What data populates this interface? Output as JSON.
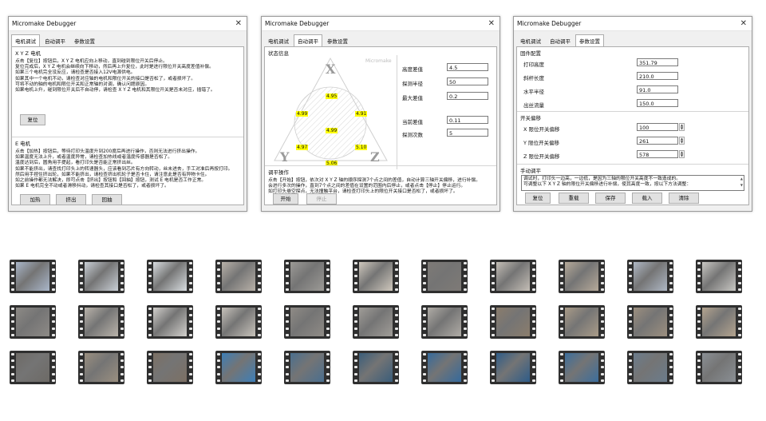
{
  "window1": {
    "title": "Micromake Debugger",
    "tabs": [
      "电机调试",
      "自动调平",
      "参数设置"
    ],
    "xyz_group": {
      "title": "X Y Z 电机",
      "text": "点击【复位】按钮后，X Y Z 电机应向上移动，直到碰到限位开关后停止。\n复位完成后，X Y Z 电机会继续向下移动，然后再上升复位，此时是进行限位开关高度差值补偿。\n如果三个电机完全没反应，请检查是否接入12V电源供电。\n如果其中一个电机不动，请检查对应轴的电机和限位开关的接口是否松了，或者损坏了。\n可将不动的轴的电机和限位开关和正常轴的对调，确认问题原因。\n如果电机上升，碰到限位开关后不自动停，请检查 X Y Z 电机和其限位开关是否未对应，插错了。",
      "reset_label": "复位"
    },
    "e_group": {
      "title": "E 电机",
      "text": "点击【加热】按钮后，等待打印头温度升到200度后再进行操作，否则无法进行挤出操作。\n如果温度无法上升，或者温度异常，请检查加热线或者温度传感器是否松了。\n温度达到后，圆角用手提起，看打印头是否能正常挤出丝。\n如果不能挤出，请查找打印头上的转速器头，应该看到芯片有方向转动，丝未进去，手工对准后再按打印。\n然后用手捏住挤出轮，如果不能挤出，请检查挤出机轮子是否卡住，请注意此是否有异物卡住。\n如之前操作都无法解决，即可点击【挤出】按钮和【回抽】按钮，测试 E 电机是否工作正常。\n如果 E 电机完全不动或者滑移抖动，请检查其接口是否松了，或者损坏了。",
      "buttons": [
        "加热",
        "挤出",
        "回抽"
      ]
    }
  },
  "window2": {
    "title": "Micromake Debugger",
    "tabs": [
      "电机调试",
      "自动调平",
      "参数设置"
    ],
    "status_title": "状态信息",
    "watermark": "Micromake",
    "tower_labels": [
      "X",
      "Y",
      "Z"
    ],
    "probe_values": [
      "4.95",
      "4.99",
      "4.91",
      "4.99",
      "4.97",
      "5.10",
      "5.06"
    ],
    "fields": [
      {
        "label": "高度差值",
        "value": "4.5"
      },
      {
        "label": "探测半径",
        "value": "50"
      },
      {
        "label": "最大差值",
        "value": "0.2"
      },
      {
        "label": "当前差值",
        "value": "0.11"
      },
      {
        "label": "探测次数",
        "value": "5"
      }
    ],
    "leveling": {
      "title": "调平操作",
      "text": "点击【开始】按钮，依次对 X Y Z 轴的顺序探测7个点之间的差值，自动计算三轴开关偏移，进行补偿。\n会进行多次的操作，直到7个点之间的差值在设置的范围内后停止，或者点击【停止】停止运行。\n如打印头悬空探点，无法撞触平台，请检查打印头上的限位开关接口是否松了，或者损坏了。",
      "start_label": "开始",
      "stop_label": "停止"
    }
  },
  "window3": {
    "title": "Micromake Debugger",
    "tabs": [
      "电机调试",
      "自动调平",
      "参数设置"
    ],
    "firmware": {
      "title": "固件配置",
      "fields": [
        {
          "label": "打印高度",
          "value": "351.79"
        },
        {
          "label": "斜杆长度",
          "value": "210.0"
        },
        {
          "label": "水平半径",
          "value": "91.0"
        },
        {
          "label": "出丝流量",
          "value": "150.0"
        }
      ]
    },
    "endstop": {
      "title": "开关偏移",
      "fields": [
        {
          "label": "X 限位开关偏移",
          "value": "100"
        },
        {
          "label": "Y 限位开关偏移",
          "value": "261"
        },
        {
          "label": "Z 限位开关偏移",
          "value": "578"
        }
      ]
    },
    "manual": {
      "title": "手动调平",
      "text": "调试时，打印头一边高，一边低，是因为三轴的限位开关高度不一致造成的。\n可调整以下 X Y Z 轴的限位开关偏移进行补偿，使其高度一致，按以下方法调整："
    },
    "buttons": [
      "复位",
      "重载",
      "保存",
      "载入",
      "清除"
    ]
  },
  "filmstrip": {
    "rows": [
      [
        "#a9b6c9",
        "#c9cfd6",
        "#d8dde0",
        "#b8b1a8",
        "#9c9a96",
        "#cfc8bd",
        "#7e7a76",
        "#c4beb6",
        "#b5a999",
        "#aeb7c4",
        "#c8c7c3"
      ],
      [
        "#8d8a86",
        "#b9b3aa",
        "#d2d0cc",
        "#c8c3bb",
        "#8f8b86",
        "#a09d98",
        "#b0aca6",
        "#8b7d6c",
        "#a99b88",
        "#9c8f7f",
        "#b4a48f"
      ],
      [
        "#6d6a66",
        "#9a8f80",
        "#7c7064",
        "#3d7fb8",
        "#4a6f8f",
        "#3a5d7a",
        "#356a9c",
        "#2e5c88",
        "#3c6e9c",
        "#6b7c8c",
        "#8a8f94"
      ]
    ]
  }
}
